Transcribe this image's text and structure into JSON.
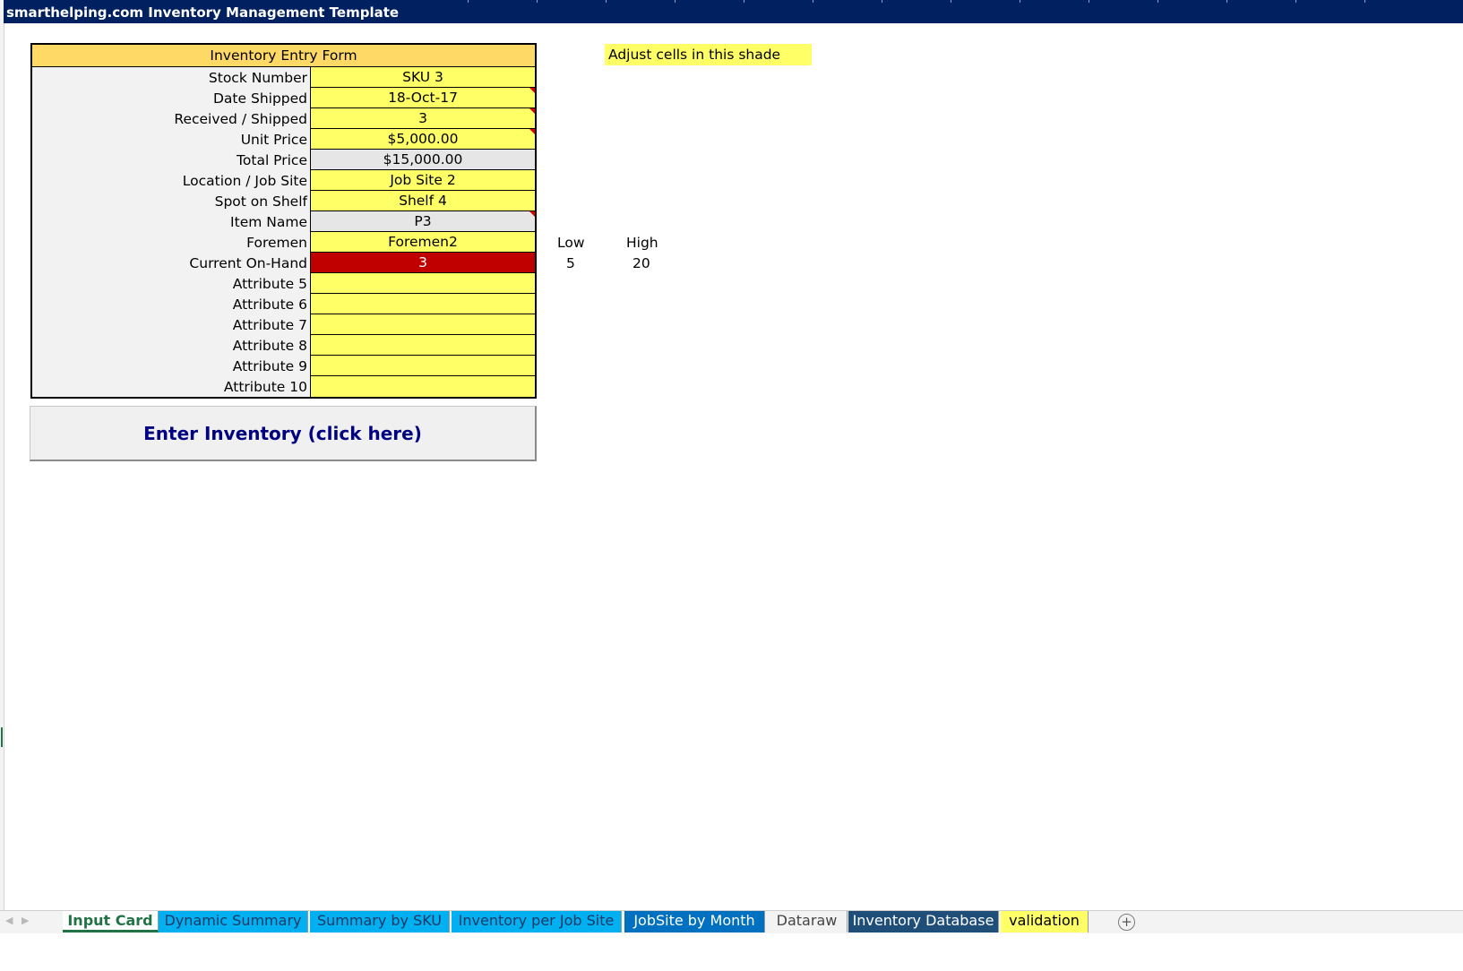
{
  "header": {
    "title": "smarthelping.com Inventory Management Template"
  },
  "form": {
    "title": "Inventory Entry Form",
    "rows": [
      {
        "label": "Stock Number",
        "value": "SKU 3"
      },
      {
        "label": "Date Shipped",
        "value": "18-Oct-17"
      },
      {
        "label": "Received / Shipped",
        "value": "3"
      },
      {
        "label": "Unit Price",
        "value": "$5,000.00"
      },
      {
        "label": "Total Price",
        "value": "$15,000.00"
      },
      {
        "label": "Location / Job Site",
        "value": "Job Site 2"
      },
      {
        "label": "Spot on Shelf",
        "value": "Shelf 4"
      },
      {
        "label": "Item Name",
        "value": "P3"
      },
      {
        "label": "Foremen",
        "value": "Foremen2"
      },
      {
        "label": "Current On-Hand",
        "value": "3"
      },
      {
        "label": "Attribute 5",
        "value": ""
      },
      {
        "label": "Attribute 6",
        "value": ""
      },
      {
        "label": "Attribute 7",
        "value": ""
      },
      {
        "label": "Attribute 8",
        "value": ""
      },
      {
        "label": "Attribute 9",
        "value": ""
      },
      {
        "label": "Attribute 10",
        "value": ""
      }
    ]
  },
  "enter_button": {
    "label": "Enter Inventory (click here)"
  },
  "note": {
    "text": "Adjust cells in this shade"
  },
  "thresholds": {
    "low_label": "Low",
    "high_label": "High",
    "low_value": "5",
    "high_value": "20"
  },
  "sheet_tabs": [
    {
      "label": "Input Card",
      "active": true,
      "bg": "#ffffff",
      "color": "#217346"
    },
    {
      "label": "Dynamic Summary",
      "bg": "#00b0f0",
      "color": "#1f3864"
    },
    {
      "label": "Summary by SKU",
      "bg": "#00b0f0",
      "color": "#1f3864"
    },
    {
      "label": "Inventory per Job Site",
      "bg": "#00b0f0",
      "color": "#1f3864"
    },
    {
      "label": "JobSite by Month",
      "bg": "#0070c0",
      "color": "#ffffff"
    },
    {
      "label": "Dataraw",
      "bg": "#f3f3f3",
      "color": "#444444"
    },
    {
      "label": "Inventory Database",
      "bg": "#1f4e79",
      "color": "#ffffff"
    },
    {
      "label": "validation",
      "bg": "#ffff66",
      "color": "#000000"
    }
  ],
  "colors": {
    "header_bg": "#002060",
    "form_title_bg": "#ffd966",
    "input_yellow": "#ffff66",
    "computed_gray": "#e6e6e6",
    "alert_red": "#c00000",
    "button_text": "#000080"
  },
  "icons": {
    "prev_sheet": "◀",
    "next_sheet": "▶",
    "add_sheet": "+"
  }
}
